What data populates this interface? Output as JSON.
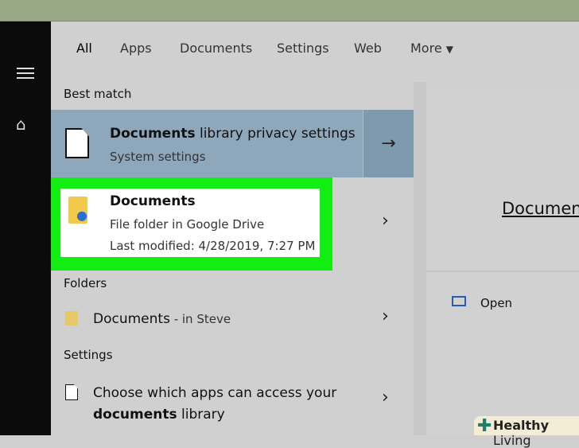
{
  "tabs": [
    "All",
    "Apps",
    "Documents",
    "Settings",
    "Web",
    "More"
  ],
  "sections": {
    "best": "Best match",
    "folders": "Folders",
    "settings": "Settings"
  },
  "best_match": {
    "title_bold": "Documents",
    "title_rest": " library privacy settings",
    "subtitle": "System settings"
  },
  "doc_result": {
    "title": "Documents",
    "line1": "File folder in Google Drive",
    "line2": "Last modified: 4/28/2019, 7:27 PM"
  },
  "folder_result": {
    "title": "Documents",
    "suffix": " - in Steve"
  },
  "setting_result": {
    "line1": "Choose which apps can access your",
    "bold": "documents",
    "rest": " library"
  },
  "preview": {
    "title": "Documents",
    "open": "Open"
  },
  "watermark": {
    "bold": "Healthy",
    "rest": " Living"
  },
  "colors": {
    "accent": "#1b5fb0",
    "highlight": "#12ee12",
    "selected": "#8fa7bb"
  }
}
